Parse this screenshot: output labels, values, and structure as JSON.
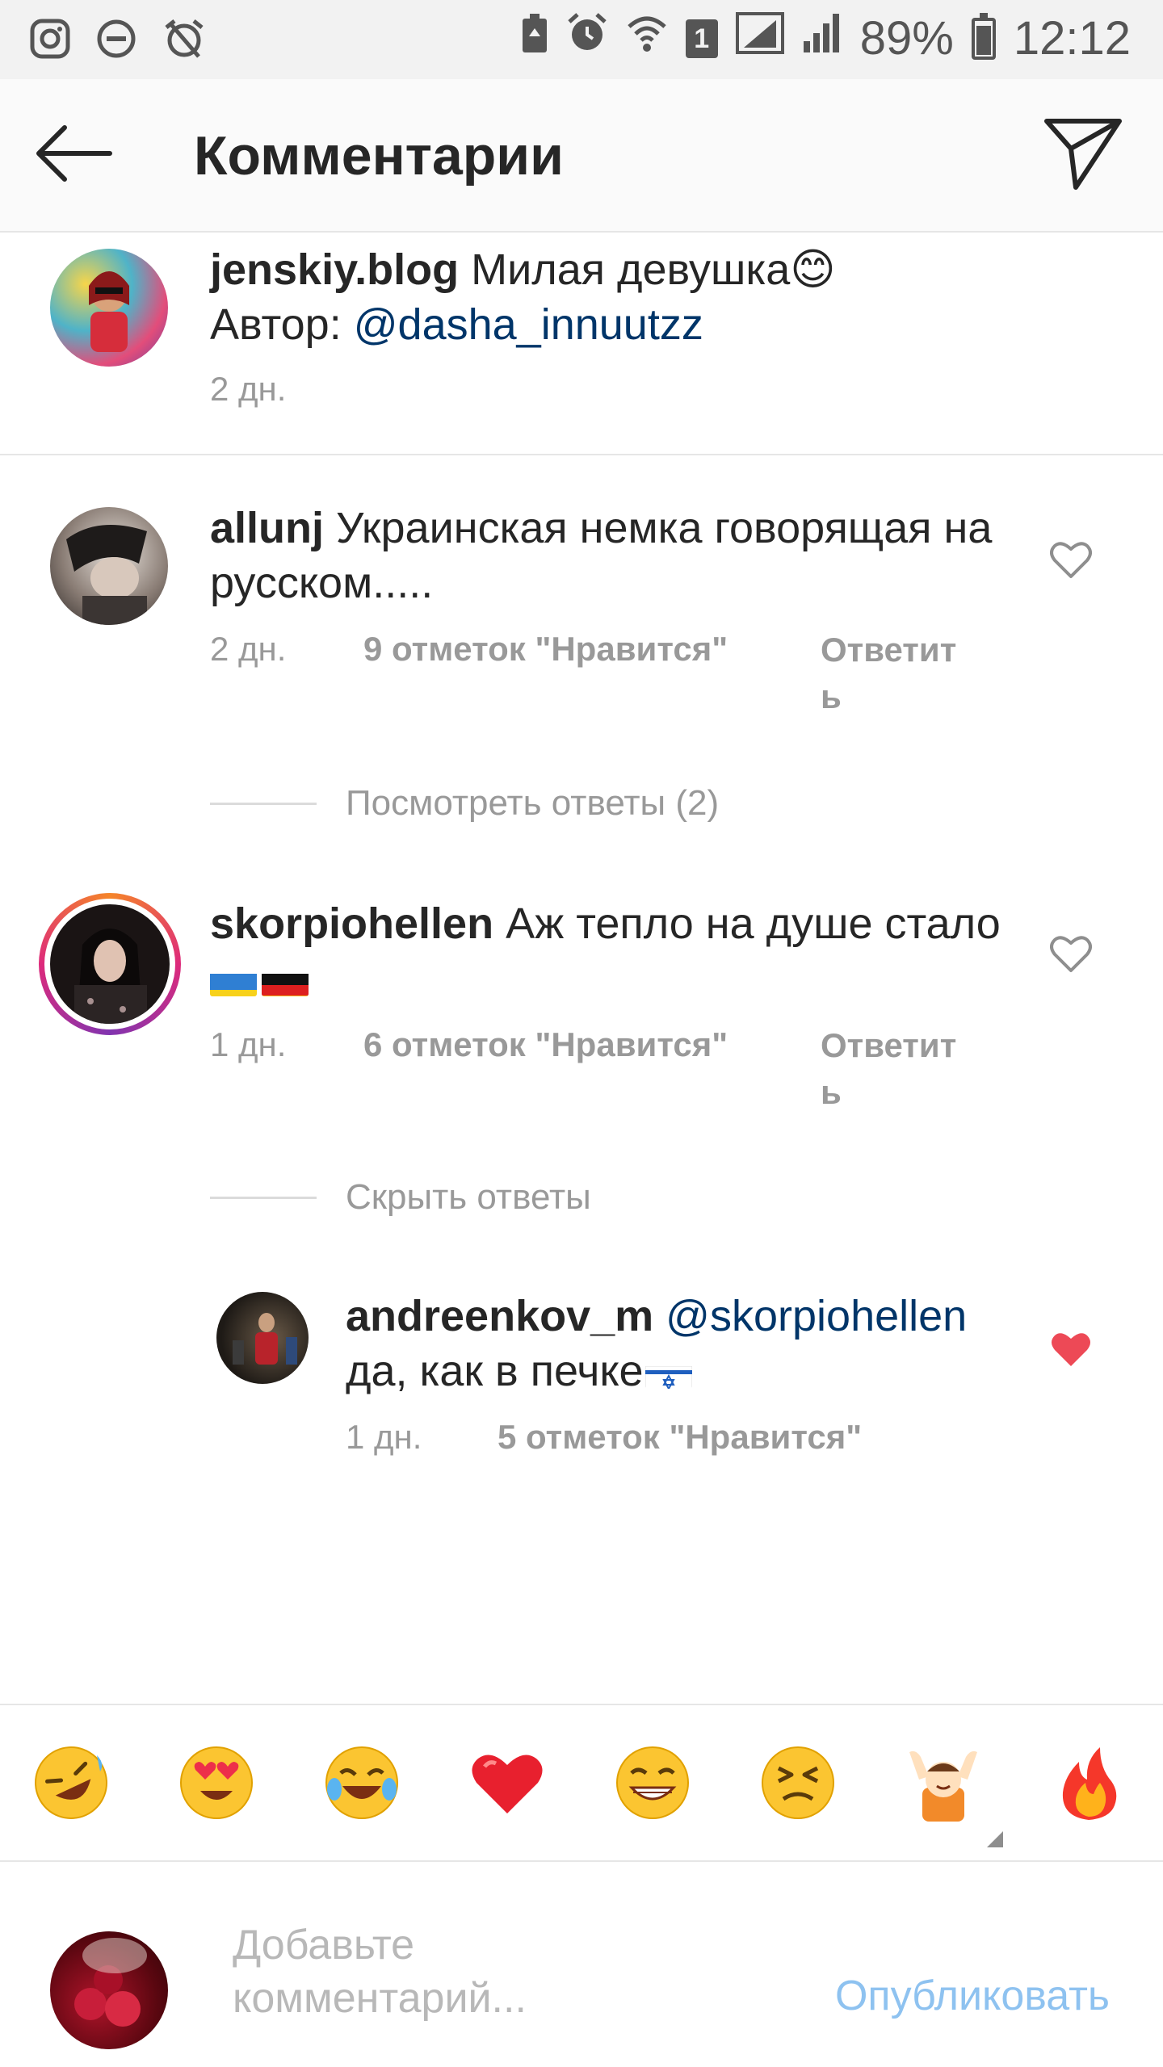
{
  "status_bar": {
    "battery": "89%",
    "time": "12:12",
    "sim_slot": "1",
    "left_icons": [
      "instagram-icon",
      "dnd-icon",
      "alarm-off-icon"
    ],
    "right_icons": [
      "battery-saver-icon",
      "alarm-icon",
      "wifi-icon",
      "sim-icon",
      "signal-icon",
      "signal-icon",
      "battery-icon"
    ]
  },
  "header": {
    "title": "Комментарии"
  },
  "caption": {
    "username": "jenskiy.blog",
    "text": " Милая девушка😊",
    "author_label": "Автор: ",
    "author_mention": "@dasha_innuutzz",
    "time": "2 дн."
  },
  "comments": [
    {
      "username": "allunj",
      "text": " Украинская немка говорящая на русском.....",
      "time": "2 дн.",
      "likes": "9 отметок \"Нравится\"",
      "reply_label": "Ответить",
      "view_replies": "Посмотреть ответы (2)",
      "liked": false
    },
    {
      "username": "skorpiohellen",
      "text": " Аж тепло на душе стало",
      "time": "1 дн.",
      "likes": "6 отметок \"Нравится\"",
      "reply_label": "Ответить",
      "hide_replies": "Скрыть ответы",
      "liked": false
    }
  ],
  "reply": {
    "username": "andreenkov_m",
    "mention": " @skorpiohellen",
    "text": "да, как в печке",
    "time": "1 дн.",
    "likes": "5 отметок \"Нравится\"",
    "liked": true
  },
  "emoji_bar": [
    "🤣",
    "😍",
    "😂",
    "❤️",
    "😁",
    "😣",
    "🙌",
    "🔥"
  ],
  "input": {
    "placeholder": "Добавьте комментарий...",
    "publish_label": "Опубликовать"
  },
  "colors": {
    "mention": "#003569",
    "liked_heart": "#ed4956",
    "meta": "#999999",
    "publish": "#8ec2f0"
  }
}
